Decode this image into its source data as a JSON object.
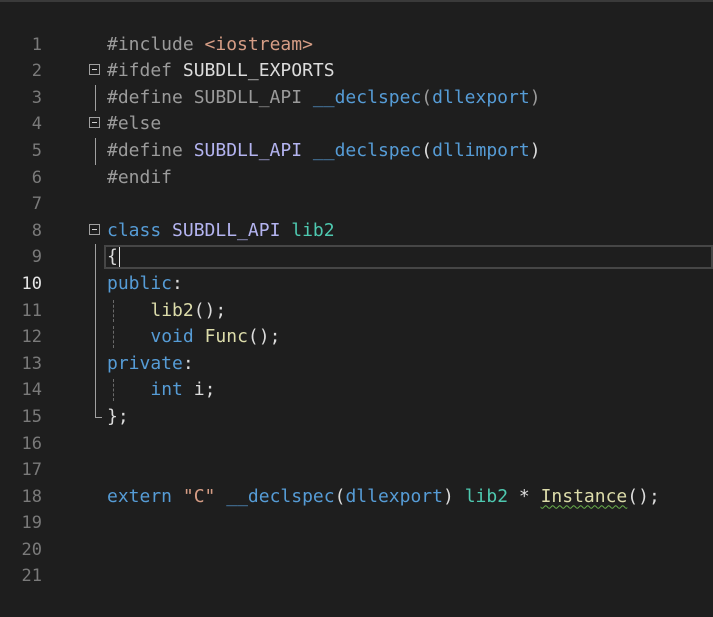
{
  "editor": {
    "line_numbers": [
      "1",
      "2",
      "3",
      "4",
      "5",
      "6",
      "7",
      "8",
      "9",
      "10",
      "11",
      "12",
      "13",
      "14",
      "15",
      "16",
      "17",
      "18",
      "19",
      "20",
      "21"
    ],
    "active_line": "10",
    "colors": {
      "background": "#1e1e1e",
      "keyword": "#569cd6",
      "preprocessor": "#9b9b9b",
      "macro": "#b4b4f0",
      "class": "#4ec9b0",
      "function": "#dcdcaa",
      "string": "#d69d85"
    },
    "code": {
      "l2_directive": "#include",
      "l2_header": "<iostream>",
      "l3_directive": "#ifdef",
      "l3_macro": "SUBDLL_EXPORTS",
      "l4_directive": "#define",
      "l4_macro": "SUBDLL_API",
      "l4_declspec": "__declspec",
      "l4_paren_open": "(",
      "l4_arg": "dllexport",
      "l4_paren_close": ")",
      "l5_directive": "#else",
      "l6_directive": "#define",
      "l6_macro": "SUBDLL_API",
      "l6_declspec": "__declspec",
      "l6_paren_open": "(",
      "l6_arg": "dllimport",
      "l6_paren_close": ")",
      "l7_directive": "#endif",
      "l9_keyword": "class",
      "l9_macro": "SUBDLL_API",
      "l9_class": "lib2",
      "l10_brace": "{",
      "l11_access": "public",
      "l11_colon": ":",
      "l12_ctor": "lib2",
      "l12_rest": "();",
      "l13_type": "void",
      "l13_func": "Func",
      "l13_rest": "();",
      "l14_access": "private",
      "l14_colon": ":",
      "l15_type": "int",
      "l15_var": "i",
      "l15_semi": ";",
      "l16_close": "};",
      "l19_extern": "extern",
      "l19_string": "\"C\"",
      "l19_declspec": "__declspec",
      "l19_paren_open": "(",
      "l19_arg": "dllexport",
      "l19_paren_close": ")",
      "l19_class": "lib2",
      "l19_star": "*",
      "l19_func": "Instance",
      "l19_rest": "();"
    }
  }
}
